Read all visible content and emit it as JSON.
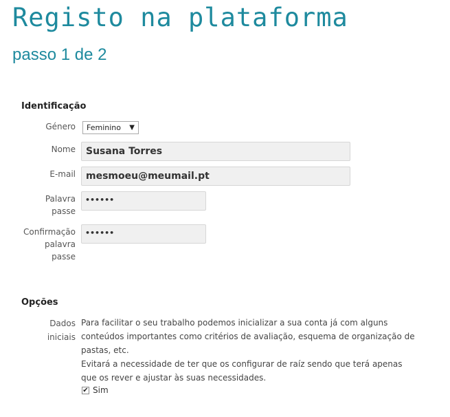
{
  "header": {
    "title": "Registo na plataforma",
    "subtitle": "passo 1 de 2"
  },
  "identificacao": {
    "section_title": "Identificação",
    "genero": {
      "label": "Género",
      "value": "Feminino"
    },
    "nome": {
      "label": "Nome",
      "value": "Susana Torres"
    },
    "email": {
      "label": "E-mail",
      "value": "mesmoeu@meumail.pt"
    },
    "palavra_passe": {
      "label_line1": "Palavra",
      "label_line2": "passe",
      "mask": "••••••"
    },
    "confirmacao": {
      "label_line1": "Confirmação",
      "label_line2": "palavra",
      "label_line3": "passe",
      "mask": "••••••"
    }
  },
  "opcoes": {
    "section_title": "Opções",
    "dados_iniciais": {
      "label_line1": "Dados",
      "label_line2": "iniciais",
      "description_line1": "Para facilitar o seu trabalho podemos inicializar a sua conta já com alguns",
      "description_line2": "conteúdos importantes como critérios de avaliação, esquema de organização de",
      "description_line3": "pastas, etc.",
      "description_line4": "Evitará a necessidade de ter que os configurar de raíz sendo que terá apenas",
      "description_line5": "que os rever e ajustar às suas necessidades.",
      "checkbox_label": "Sim",
      "checked": true
    }
  }
}
